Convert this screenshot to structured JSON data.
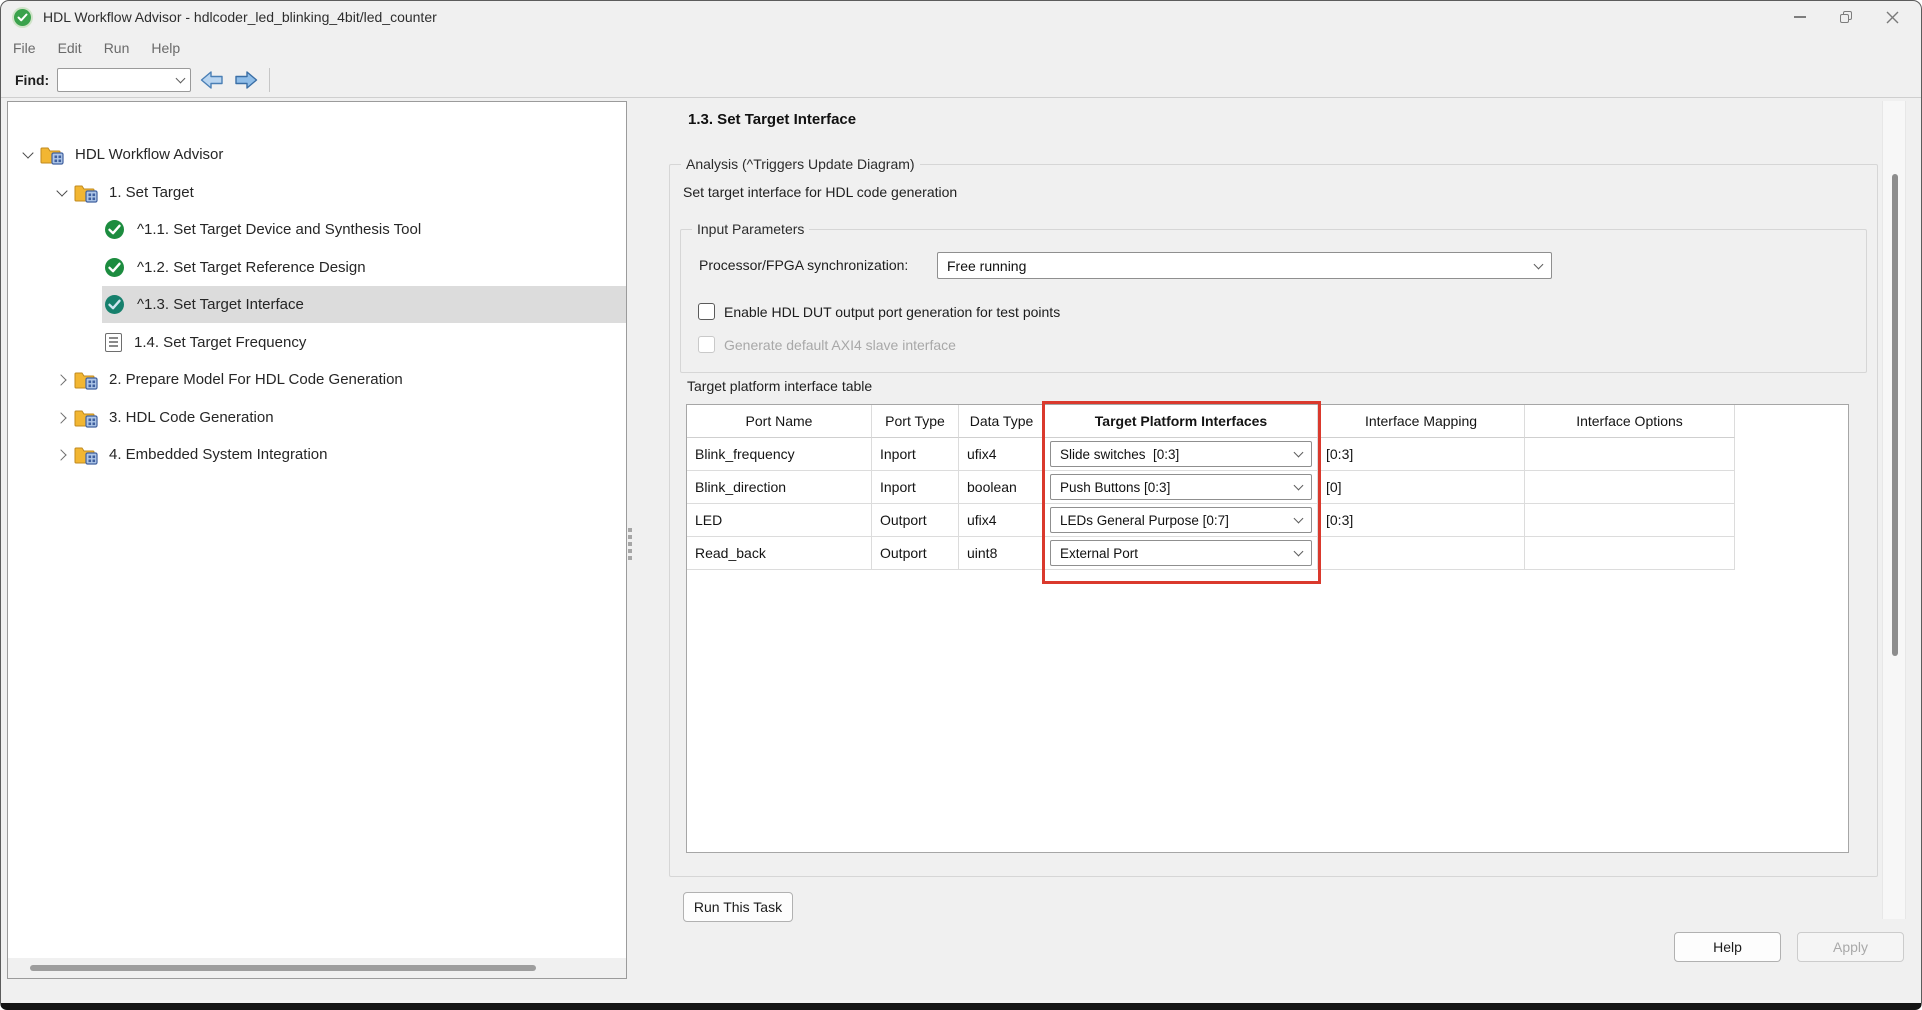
{
  "window": {
    "title": "HDL Workflow Advisor - hdlcoder_led_blinking_4bit/led_counter"
  },
  "menu": {
    "items": [
      "File",
      "Edit",
      "Run",
      "Help"
    ]
  },
  "findbar": {
    "label": "Find:",
    "value": ""
  },
  "tree": {
    "items": [
      {
        "label": "HDL Workflow Advisor",
        "state": "expanded"
      },
      {
        "label": "1. Set Target",
        "state": "expanded"
      },
      {
        "label": "^1.1. Set Target Device and Synthesis Tool",
        "state": "passed"
      },
      {
        "label": "^1.2. Set Target Reference Design",
        "state": "passed"
      },
      {
        "label": "^1.3. Set Target Interface",
        "state": "passed-selected"
      },
      {
        "label": "1.4. Set Target Frequency",
        "state": "not-run"
      },
      {
        "label": "2. Prepare Model For HDL Code Generation",
        "state": "collapsed"
      },
      {
        "label": "3. HDL Code Generation",
        "state": "collapsed"
      },
      {
        "label": "4. Embedded System Integration",
        "state": "collapsed"
      }
    ]
  },
  "content": {
    "heading": "1.3. Set Target Interface",
    "analysis_legend": "Analysis (^Triggers Update Diagram)",
    "description": "Set target interface for HDL code generation",
    "input_parameters_legend": "Input Parameters",
    "sync_label": "Processor/FPGA synchronization:",
    "sync_value": "Free running",
    "checkbox_test_points": "Enable HDL DUT output port generation for test points",
    "checkbox_axi4": "Generate default AXI4 slave interface",
    "table_label": "Target platform interface table",
    "table": {
      "headers": [
        "Port Name",
        "Port Type",
        "Data Type",
        "Target Platform Interfaces",
        "Interface Mapping",
        "Interface Options"
      ],
      "rows": [
        {
          "port_name": "Blink_frequency",
          "port_type": "Inport",
          "data_type": "ufix4",
          "interface": "Slide switches  [0:3]",
          "mapping": "[0:3]",
          "options": ""
        },
        {
          "port_name": "Blink_direction",
          "port_type": "Inport",
          "data_type": "boolean",
          "interface": "Push Buttons [0:3]",
          "mapping": "[0]",
          "options": ""
        },
        {
          "port_name": "LED",
          "port_type": "Outport",
          "data_type": "ufix4",
          "interface": "LEDs General Purpose [0:7]",
          "mapping": "[0:3]",
          "options": ""
        },
        {
          "port_name": "Read_back",
          "port_type": "Outport",
          "data_type": "uint8",
          "interface": "External Port",
          "mapping": "",
          "options": ""
        }
      ]
    },
    "run_button": "Run This Task",
    "help_button": "Help",
    "apply_button": "Apply"
  },
  "colors": {
    "highlight_red": "#da392d",
    "check_green": "#1c8c3f",
    "selected_check_teal": "#16806c",
    "folder_gold": "#f2b632",
    "nav_arrow_blue": "#8fbde8",
    "selection_gray": "#dcdcdc"
  }
}
